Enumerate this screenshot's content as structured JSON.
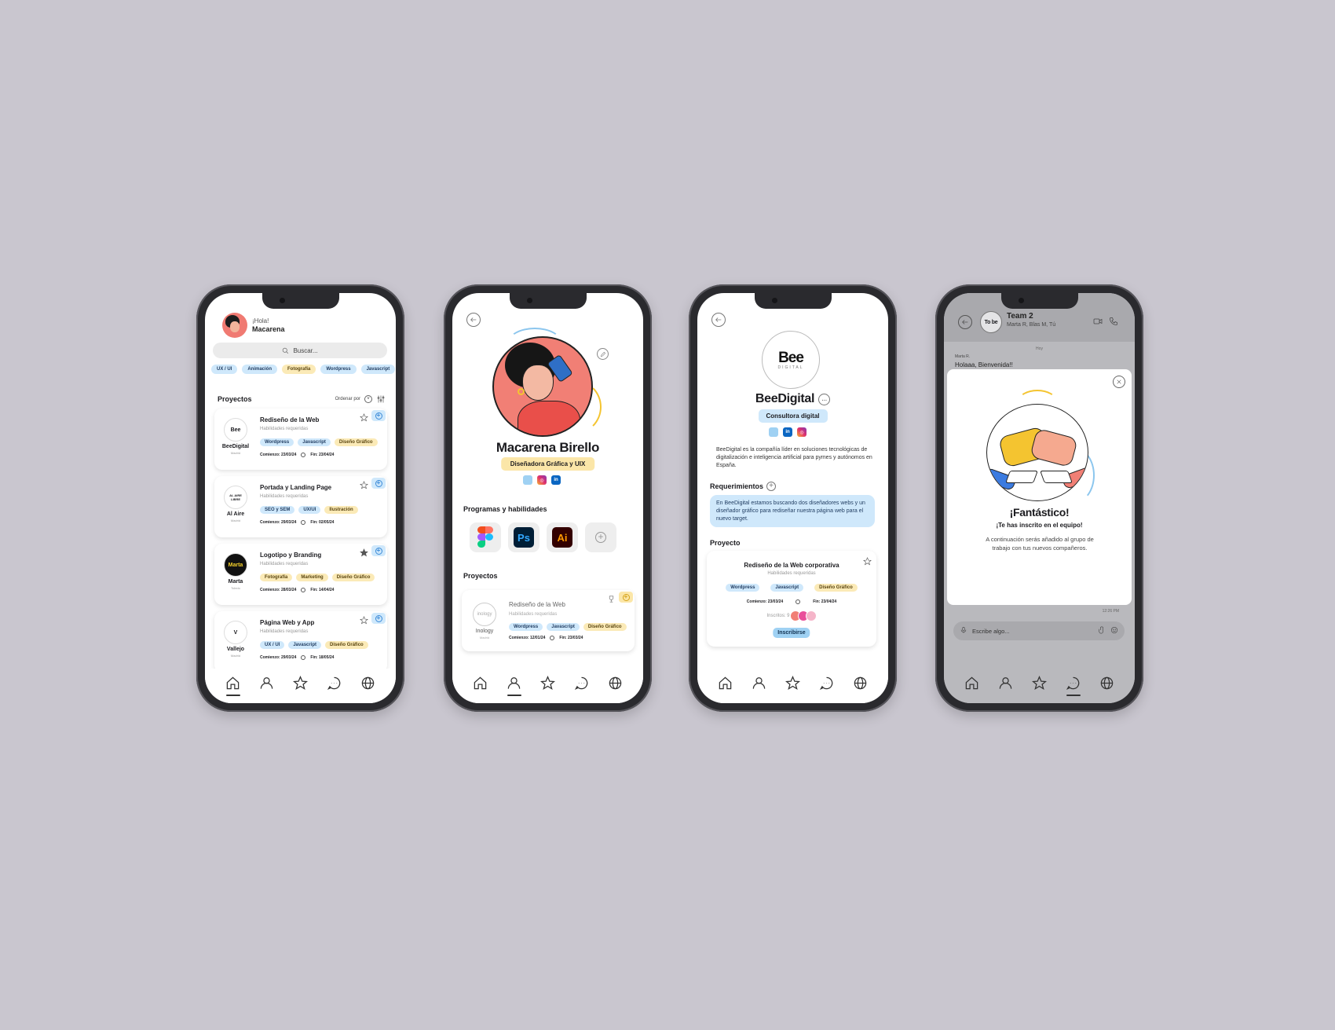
{
  "nav_icons": [
    "home-icon",
    "user-icon",
    "star-icon",
    "chat-icon",
    "globe-icon"
  ],
  "phone1": {
    "greeting": "¡Hola!",
    "user_name": "Macarena",
    "search_placeholder": "Buscar...",
    "filters": [
      {
        "label": "UX / UI",
        "color": "blue"
      },
      {
        "label": "Animación",
        "color": "blue"
      },
      {
        "label": "Fotografía",
        "color": "yellow"
      },
      {
        "label": "Wordpress",
        "color": "blue"
      },
      {
        "label": "Javascript",
        "color": "blue"
      }
    ],
    "section_title": "Proyectos",
    "sort_label": "Ordenar por",
    "projects": [
      {
        "title": "Rediseño de la Web",
        "subtitle": "Habilidades requeridas",
        "company": "BeeDigital",
        "city": "Madrid",
        "logo_text": "Bee",
        "logo_dark": false,
        "tags": [
          {
            "label": "Wordpress",
            "color": "blue"
          },
          {
            "label": "Javascript",
            "color": "blue"
          },
          {
            "label": "Diseño Gráfico",
            "color": "yellow"
          }
        ],
        "start": "Comienzo: 23/03/24",
        "end": "Fin: 23/04/24",
        "starred": false
      },
      {
        "title": "Portada y Landing Page",
        "subtitle": "Habilidades requeridas",
        "company": "Al Aire",
        "city": "Madrid",
        "logo_text": "AL AIRE LIBRE",
        "logo_dark": false,
        "tags": [
          {
            "label": "SEO y SEM",
            "color": "blue"
          },
          {
            "label": "UX/UI",
            "color": "blue"
          },
          {
            "label": "Ilustración",
            "color": "yellow"
          }
        ],
        "start": "Comienzo: 29/03/24",
        "end": "Fin: 02/05/24",
        "starred": false
      },
      {
        "title": "Logotipo y Branding",
        "subtitle": "Habilidades requeridas",
        "company": "Marta",
        "city": "Toledo",
        "logo_text": "Marta",
        "logo_dark": true,
        "tags": [
          {
            "label": "Fotografía",
            "color": "yellow"
          },
          {
            "label": "Marketing",
            "color": "yellow"
          },
          {
            "label": "Diseño Gráfico",
            "color": "yellow"
          }
        ],
        "start": "Comienzo: 28/03/24",
        "end": "Fin: 14/04/24",
        "starred": true
      },
      {
        "title": "Página Web y App",
        "subtitle": "Habilidades requeridas",
        "company": "Vallejo",
        "city": "Madrid",
        "logo_text": "V",
        "logo_dark": false,
        "tags": [
          {
            "label": "UX / UI",
            "color": "blue"
          },
          {
            "label": "Javascript",
            "color": "blue"
          },
          {
            "label": "Diseño Gráfico",
            "color": "yellow"
          }
        ],
        "start": "Comienzo: 29/03/24",
        "end": "Fin: 18/05/24",
        "starred": false
      }
    ]
  },
  "phone2": {
    "name": "Macarena Birello",
    "role": "Diseñadora Gráfica y UIX",
    "section_skills": "Programas y habilidades",
    "skills": [
      "Ps",
      "Ai"
    ],
    "section_projects": "Proyectos",
    "project": {
      "title": "Rediseño de la Web",
      "subtitle": "Habilidades requeridas",
      "company": "Inology",
      "city": "Madrid",
      "logo_text": "inology",
      "tags": [
        {
          "label": "Wordpress",
          "color": "blue"
        },
        {
          "label": "Javascript",
          "color": "blue"
        },
        {
          "label": "Diseño Gráfico",
          "color": "yellow"
        }
      ],
      "start": "Comienzo: 12/01/24",
      "end": "Fin: 23/03/24"
    }
  },
  "phone3": {
    "logo_main": "Bee",
    "logo_sub": "DIGITAL",
    "name": "BeeDigital",
    "role": "Consultora digital",
    "description": "BeeDigital es la compañía líder en soluciones tecnológicas de digitalización e inteligencia artificial para pymes y autónomos en España.",
    "requirements_title": "Requerimientos",
    "requirements_text": "En BeeDigital estamos buscando dos diseñadores webs y un diseñador gráfico para rediseñar nuestra página web para el nuevo target.",
    "project_title": "Proyecto",
    "card": {
      "title": "Rediseño de la Web corporativa",
      "subtitle": "Habilidades requeridas",
      "tags": [
        {
          "label": "Wordpress",
          "color": "blue"
        },
        {
          "label": "Javascript",
          "color": "blue"
        },
        {
          "label": "Diseño Gráfico",
          "color": "yellow"
        }
      ],
      "start": "Comienzo: 23/03/24",
      "end": "Fin: 23/04/24",
      "enrolled": "Inscritos: 9",
      "button": "Inscribirse"
    }
  },
  "phone4": {
    "team_logo": "To be",
    "team_name": "Team 2",
    "members": "Marta R, Blas M, Tú",
    "day_label": "Hoy",
    "sender": "Marta R.",
    "message": "Holaaa, Bienvenida!!",
    "modal_title": "¡Fantástico!",
    "modal_subtitle": "¡Te has inscrito en el equipo!",
    "modal_text": "A continuación serás añadido al grupo de trabajo con tus nuevos compañeros.",
    "time": "12:26 PM",
    "input_placeholder": "Escribe algo..."
  }
}
